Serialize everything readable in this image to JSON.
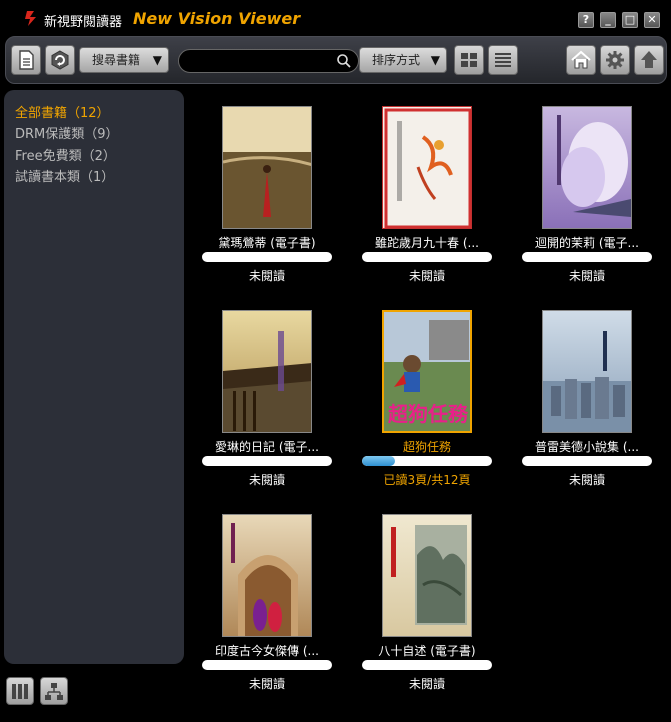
{
  "window": {
    "title_cn": "新視野閱讀器",
    "title_en": "New Vision Viewer"
  },
  "toolbar": {
    "search_dropdown_label": "搜尋書籍",
    "search_placeholder": "",
    "sort_dropdown_label": "排序方式"
  },
  "sidebar": {
    "categories": [
      {
        "label": "全部書籍（12）",
        "active": true
      },
      {
        "label": "DRM保護類（9）",
        "active": false
      },
      {
        "label": "Free免費類（2）",
        "active": false
      },
      {
        "label": "試讀書本類（1）",
        "active": false
      }
    ]
  },
  "books": [
    {
      "title": "黛瑪鶯蒂 (電子書)",
      "status": "未閱讀",
      "progress": 0
    },
    {
      "title": "雖跎歲月九十春 (...",
      "status": "未閱讀",
      "progress": 0
    },
    {
      "title": "迴開的茉莉 (電子...",
      "status": "未閱讀",
      "progress": 0
    },
    {
      "title": "愛琳的日記 (電子...",
      "status": "未閱讀",
      "progress": 0
    },
    {
      "title": "超狗任務",
      "status": "已讀3頁/共12頁",
      "progress": 0.25,
      "cover_text": "超狗任務"
    },
    {
      "title": "普雷美德小說集 (...",
      "status": "未閱讀",
      "progress": 0
    },
    {
      "title": "印度古今女傑傳 (...",
      "status": "未閱讀",
      "progress": 0
    },
    {
      "title": "八十自述 (電子書)",
      "status": "未閱讀",
      "progress": 0
    }
  ],
  "colors": {
    "accent": "#f0a400",
    "progress_fill": "#2e8fd0"
  }
}
